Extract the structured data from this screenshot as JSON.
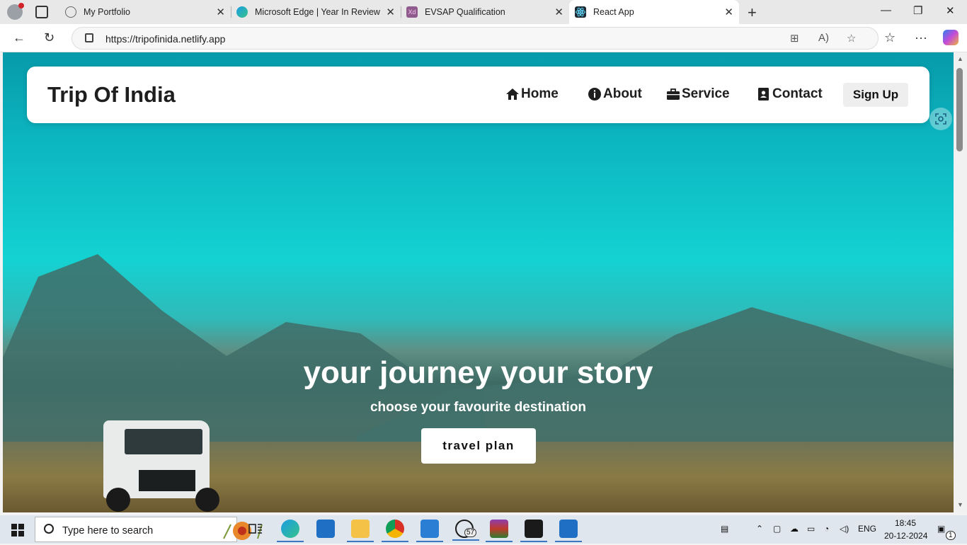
{
  "browser": {
    "tabs": [
      {
        "title": "My Portfolio",
        "favicon": "globe-icon"
      },
      {
        "title": "Microsoft Edge | Year In Review",
        "favicon": "edge-icon"
      },
      {
        "title": "EVSAP Qualification",
        "favicon": "xd-icon"
      },
      {
        "title": "React App",
        "favicon": "react-icon",
        "active": true
      }
    ],
    "url": "https://tripofinida.netlify.app"
  },
  "page": {
    "brand": "Trip Of India",
    "nav": [
      {
        "label": "Home",
        "icon": "house-icon"
      },
      {
        "label": "About",
        "icon": "info-circle-icon"
      },
      {
        "label": "Service",
        "icon": "briefcase-icon"
      },
      {
        "label": "Contact",
        "icon": "contact-card-icon"
      }
    ],
    "signup_label": "Sign Up",
    "hero": {
      "title": "your journey your story",
      "subtitle": "choose your favourite destination",
      "button": "travel plan"
    }
  },
  "taskbar": {
    "search_placeholder": "Type here to search",
    "whatsapp_badge": "57",
    "language": "ENG",
    "time": "18:45",
    "date": "20-12-2024",
    "notifications": "1"
  },
  "colors": {
    "sky": "#14d2d2",
    "accent": "#3a76c2"
  }
}
